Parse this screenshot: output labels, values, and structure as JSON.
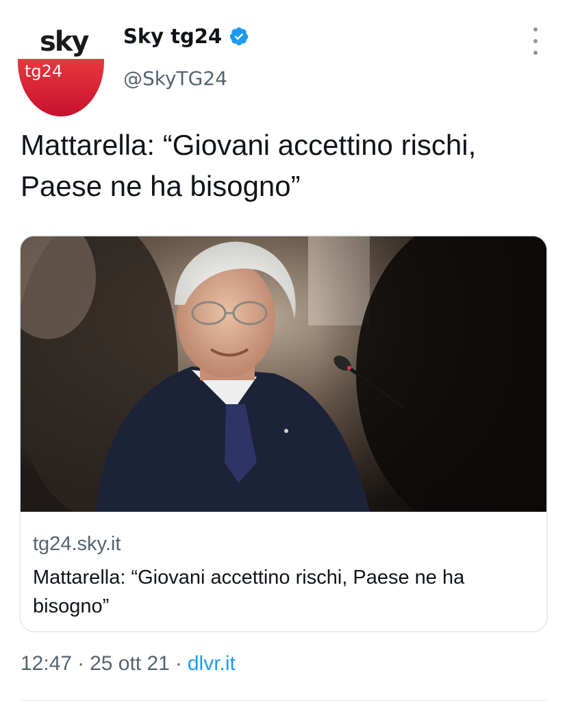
{
  "account": {
    "avatar_top_text": "sky",
    "avatar_bottom_text": "tg24",
    "display_name": "Sky tg24",
    "handle": "@SkyTG24",
    "verified": true
  },
  "tweet": {
    "text": "Mattarella: “Giovani accettino rischi, Paese ne ha bisogno”"
  },
  "card": {
    "domain": "tg24.sky.it",
    "title": "Mattarella: “Giovani accettino rischi, Paese ne ha bisogno”"
  },
  "meta": {
    "time": "12:47",
    "separator1": "·",
    "date": "25 ott 21",
    "separator2": "·",
    "source": "dlvr.it"
  },
  "colors": {
    "brand_red": "#c8102e",
    "verified_blue": "#1d9bf0",
    "secondary_text": "#536471"
  },
  "icons": {
    "verified": "verified-badge-icon",
    "more": "more-vertical-icon"
  }
}
